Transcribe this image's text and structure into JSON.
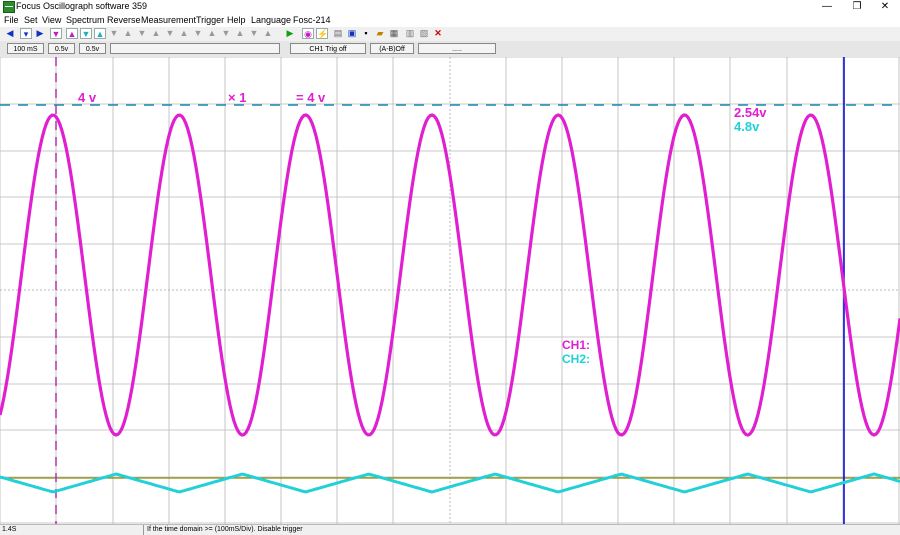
{
  "window": {
    "title": "Focus Oscillograph software 359",
    "minimize": "—",
    "maximize": "❐",
    "close": "✕"
  },
  "menu": [
    "File",
    "Set",
    "View",
    "Spectrum",
    "Reverse",
    "Measurement",
    "Trigger",
    "Help",
    "Language",
    "Fosc-214"
  ],
  "status_fields": {
    "timebase": "100 mS",
    "ch1_scale": "0.5v",
    "ch2_scale": "0.5v",
    "trigger": "CH1 Trig off",
    "math": "(A-B)Off",
    "extra": "....."
  },
  "overlay": {
    "level_value": "4 v",
    "probe": "× 1",
    "equals_value": "= 4 v",
    "ch1_reading": "2.54v",
    "ch2_reading": "4.8v",
    "ch1_label": "CH1:",
    "ch2_label": "CH2:"
  },
  "colors": {
    "ch1": "#e020d0",
    "ch2": "#22d0d8",
    "grid": "#b8b8b8",
    "ref_line": "#1a8ab0",
    "cursor_v1": "#b030b0",
    "cursor_v2": "#0000e0",
    "trig_level": "#8a8a00"
  },
  "bottom": {
    "left": "1.4S",
    "message": "If the time domain >= (100mS/Div). Disable trigger"
  }
}
